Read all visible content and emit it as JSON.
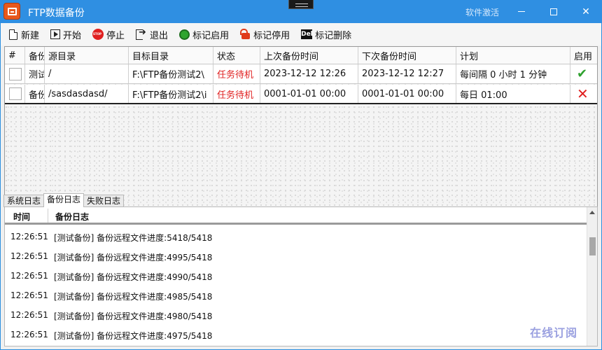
{
  "window": {
    "title": "FTP数据备份",
    "activate_label": "软件激活"
  },
  "toolbar": {
    "new_label": "新建",
    "start_label": "开始",
    "stop_label": "停止",
    "exit_label": "退出",
    "enable_label": "标记启用",
    "disable_label": "标记停用",
    "delete_label": "标记删除"
  },
  "grid": {
    "columns": [
      "#",
      "备份",
      "源目录",
      "目标目录",
      "状态",
      "上次备份时间",
      "下次备份时间",
      "计划",
      "启用"
    ],
    "rows": [
      {
        "name": "测试备份",
        "source": "/",
        "target": "F:\\FTP备份测试2\\",
        "status": "任务待机",
        "last": "2023-12-12 12:26",
        "next": "2023-12-12 12:27",
        "plan": "每间隔 0 小时 1 分钟",
        "enabled": "true"
      },
      {
        "name": "备份",
        "source": "/sasdasdasd/",
        "target": "F:\\FTP备份测试2\\i",
        "status": "任务待机",
        "last": "0001-01-01 00:00",
        "next": "0001-01-01 00:00",
        "plan": "每日 01:00",
        "enabled": "false"
      }
    ]
  },
  "tabs": [
    {
      "label": "系统日志"
    },
    {
      "label": "备份日志"
    },
    {
      "label": "失败日志"
    }
  ],
  "log": {
    "header_time": "时间",
    "header_log": "备份日志",
    "rows": [
      {
        "time": "12:26:51",
        "msg": "[测试备份] 备份远程文件进度:5418/5418"
      },
      {
        "time": "12:26:51",
        "msg": "[测试备份] 备份远程文件进度:4995/5418"
      },
      {
        "time": "12:26:51",
        "msg": "[测试备份] 备份远程文件进度:4990/5418"
      },
      {
        "time": "12:26:51",
        "msg": "[测试备份] 备份远程文件进度:4985/5418"
      },
      {
        "time": "12:26:51",
        "msg": "[测试备份] 备份远程文件进度:4980/5418"
      },
      {
        "time": "12:26:51",
        "msg": "[测试备份] 备份远程文件进度:4975/5418"
      }
    ]
  },
  "watermark": "在线订阅",
  "colors": {
    "titlebar": "#2f8fe2",
    "status_red": "#e02020",
    "enabled_green": "#2ea12e"
  }
}
